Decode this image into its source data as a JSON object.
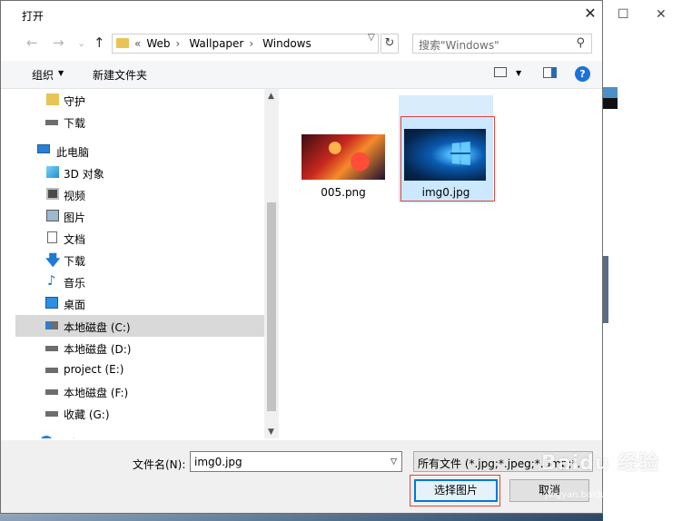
{
  "window": {
    "title": "打开",
    "close_glyph": "✕"
  },
  "nav_buttons": {
    "back": "←",
    "forward": "→",
    "recent": "⌄",
    "up": "↑"
  },
  "address": {
    "prefix": "«",
    "crumbs": [
      "Web",
      "Wallpaper",
      "Windows"
    ],
    "separator": "›"
  },
  "search": {
    "placeholder": "搜索\"Windows\""
  },
  "toolbar": {
    "organize": "组织",
    "new_folder": "新建文件夹",
    "help": "?"
  },
  "sidebar": {
    "items": [
      {
        "label": "守护",
        "icon": "folder-icon"
      },
      {
        "label": "下载",
        "icon": "drive-icon"
      },
      {
        "label": "此电脑",
        "icon": "computer-icon"
      },
      {
        "label": "3D 对象",
        "icon": "cube-3d-icon"
      },
      {
        "label": "视频",
        "icon": "video-icon"
      },
      {
        "label": "图片",
        "icon": "pictures-icon"
      },
      {
        "label": "文档",
        "icon": "document-icon"
      },
      {
        "label": "下载",
        "icon": "download-arrow-icon"
      },
      {
        "label": "音乐",
        "icon": "music-note-icon"
      },
      {
        "label": "桌面",
        "icon": "desktop-icon"
      },
      {
        "label": "本地磁盘 (C:)",
        "icon": "windows-drive-icon",
        "selected": true
      },
      {
        "label": "本地磁盘 (D:)",
        "icon": "drive-icon"
      },
      {
        "label": "project (E:)",
        "icon": "drive-icon"
      },
      {
        "label": "本地磁盘 (F:)",
        "icon": "drive-icon"
      },
      {
        "label": "收藏 (G:)",
        "icon": "drive-icon"
      },
      {
        "label": "网络",
        "icon": "network-icon"
      }
    ]
  },
  "files": [
    {
      "name": "005.png",
      "selected": false
    },
    {
      "name": "img0.jpg",
      "selected": true
    }
  ],
  "bottom": {
    "filename_label": "文件名(N):",
    "filename_value": "img0.jpg",
    "filetype_value": "所有文件 (*.jpg;*.jpeg;*.bmp;*.",
    "open_button": "选择图片",
    "cancel_button": "取消"
  },
  "background_window": {
    "maximize": "☐",
    "close": "✕"
  },
  "watermark": {
    "text": "Baidu 经验",
    "sub": "jingyan.baidu.com"
  },
  "colors": {
    "accent": "#0078d7",
    "selection": "#cce8ff",
    "highlight_box": "#e0433a"
  }
}
